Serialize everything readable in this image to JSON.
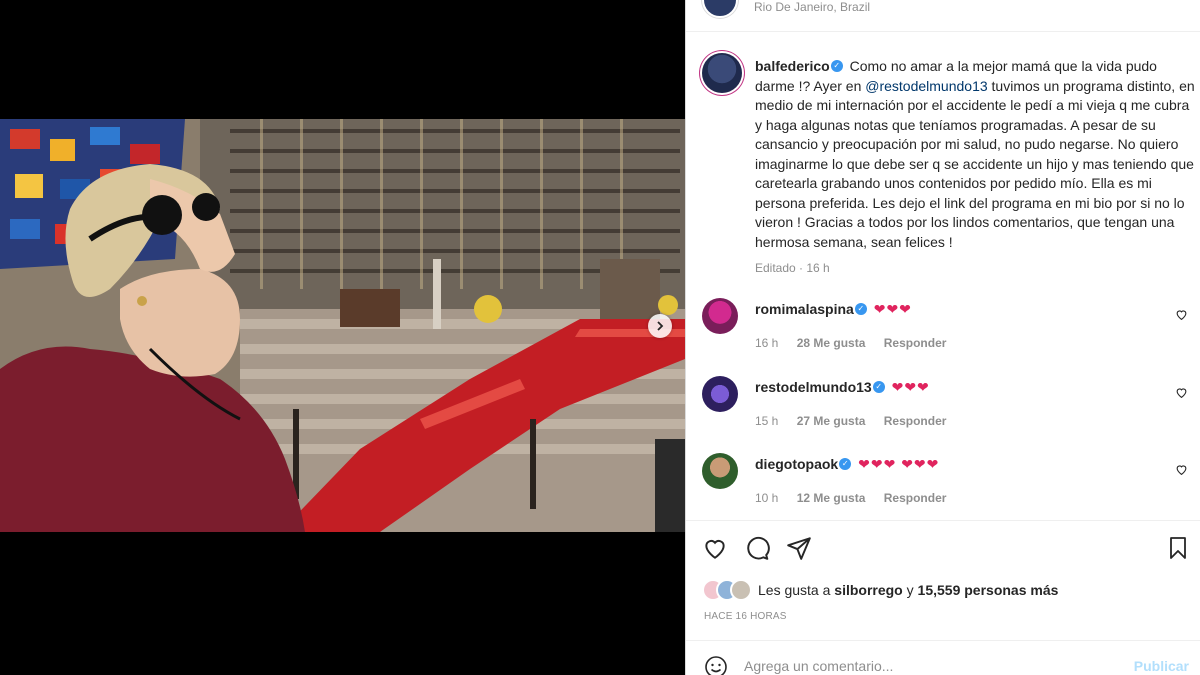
{
  "location": "Rio De Janeiro, Brazil",
  "caption": {
    "username": "balfederico",
    "text_1": "Como no amar a la mejor mamá que la vida pudo darme !? Ayer en ",
    "mention": "@restodelmundo13",
    "text_2": " tuvimos un programa distinto, en medio de mi internación por el accidente le pedí a mi vieja q me cubra y haga algunas notas que teníamos programadas. A pesar de su cansancio y preocupación por mi salud, no pudo negarse. No quiero imaginarme lo que debe ser q se accidente un hijo y mas teniendo que caretearla grabando unos contenidos por pedido mío. Ella es mi persona preferida. Les dejo el link del programa en mi bio por si no lo vieron ! Gracias a todos por los lindos comentarios, que tengan una hermosa semana, sean felices !",
    "edited": "Editado",
    "time": "16 h"
  },
  "comments": [
    {
      "username": "romimalaspina",
      "text": "❤❤❤",
      "time": "16 h",
      "likes": "28 Me gusta",
      "reply": "Responder"
    },
    {
      "username": "restodelmundo13",
      "text": "❤❤❤",
      "time": "15 h",
      "likes": "27 Me gusta",
      "reply": "Responder"
    },
    {
      "username": "diegotopaok",
      "text": "❤❤❤ ❤❤❤",
      "time": "10 h",
      "likes": "12 Me gusta",
      "reply": "Responder"
    }
  ],
  "likes": {
    "prefix": "Les gusta a ",
    "user": "silborrego",
    "connector": " y ",
    "count": "15,559 personas más"
  },
  "posted_ago": "HACE 16 HORAS",
  "add_comment": {
    "placeholder": "Agrega un comentario...",
    "post_label": "Publicar"
  },
  "carousel": {
    "total": 5,
    "active": 3
  },
  "colors": {
    "accent": "#3897f0",
    "heart": "#e0245e",
    "link": "#00376b",
    "muted": "#8e8e8e",
    "post_disabled": "#b2dffc"
  },
  "icons": [
    "verified-icon",
    "heart-icon",
    "comment-icon",
    "share-icon",
    "bookmark-icon",
    "emoji-icon",
    "chevron-right-icon"
  ]
}
